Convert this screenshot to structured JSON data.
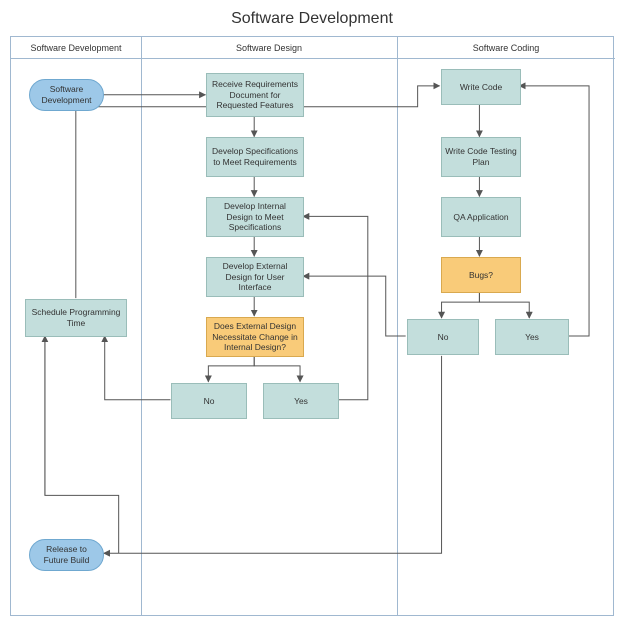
{
  "title": "Software Development",
  "lanes": {
    "l1": "Software Development",
    "l2": "Software Design",
    "l3": "Software Coding"
  },
  "nodes": {
    "start": "Software Development",
    "receive": "Receive Requirements Document for Requested Features",
    "specs": "Develop Specifications to Meet Requirements",
    "internal": "Develop Internal Design to Meet Specifications",
    "external": "Develop External Design for User Interface",
    "extq": "Does External Design Necessitate Change in Internal Design?",
    "no1": "No",
    "yes1": "Yes",
    "sched": "Schedule Programming Time",
    "write": "Write Code",
    "plan": "Write  Code Testing Plan",
    "qa": "QA Application",
    "bugs": "Bugs?",
    "no2": "No",
    "yes2": "Yes",
    "release": "Release to Future Build"
  }
}
